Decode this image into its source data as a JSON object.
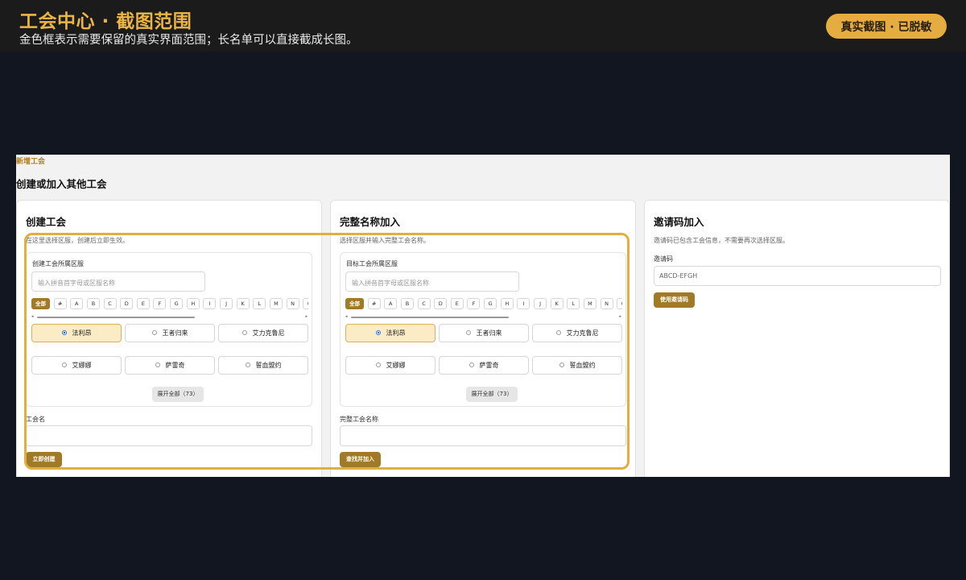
{
  "header": {
    "title": "工会中心 · 截图范围",
    "subtitle": "金色框表示需要保留的真实界面范围；长名单可以直接截成长图。",
    "badge": "真实截图 · 已脱敏"
  },
  "screenshot": {
    "breadcrumb": "新增工会",
    "page_title": "创建或加入其他工会",
    "create_card": {
      "title": "创建工会",
      "desc": "在这里选择区服，创建后立即生效。",
      "server_label": "创建工会所属区服",
      "search_placeholder": "输入拼音首字母或区服名称",
      "expand_label": "展开全部（73）",
      "name_label": "工会名",
      "submit_label": "立即创建"
    },
    "join_card": {
      "title": "完整名称加入",
      "desc": "选择区服并输入完整工会名称。",
      "server_label": "目标工会所属区服",
      "search_placeholder": "输入拼音首字母或区服名称",
      "expand_label": "展开全部（73）",
      "name_label": "完整工会名称",
      "submit_label": "查找并加入"
    },
    "invite_card": {
      "title": "邀请码加入",
      "desc": "邀请码已包含工会信息，不需要再次选择区服。",
      "code_label": "邀请码",
      "code_placeholder": "ABCD-EFGH",
      "submit_label": "使用邀请码"
    },
    "letters": [
      "全部",
      "#",
      "A",
      "B",
      "C",
      "D",
      "E",
      "F",
      "G",
      "H",
      "I",
      "J",
      "K",
      "L",
      "M",
      "N",
      "O"
    ],
    "servers": [
      {
        "name": "法利昂",
        "selected": true
      },
      {
        "name": "王者归来",
        "selected": false
      },
      {
        "name": "艾力克鲁尼",
        "selected": false
      },
      {
        "name": "艾娜娜",
        "selected": false
      },
      {
        "name": "萨雷奇",
        "selected": false
      },
      {
        "name": "誓血盟约",
        "selected": false
      }
    ]
  },
  "colors": {
    "accent_gold": "#e5ad3f",
    "button_gold": "#a07a26",
    "selected_fill": "#fbecc6",
    "page_bg": "#111620"
  },
  "icons": [
    "radio-icon",
    "scroll-left-arrow-icon",
    "scroll-right-arrow-icon"
  ]
}
